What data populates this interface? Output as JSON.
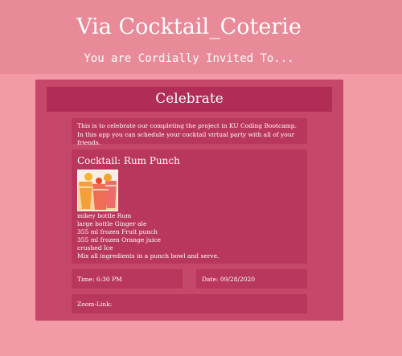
{
  "header": {
    "title": "Via Cocktail_Coterie",
    "subtitle": "You are Cordially Invited To..."
  },
  "event": {
    "title": "Celebrate",
    "description": "This is to celebrate our completing the project in KU Coding Bootcamp. In this app you can schedule your cocktail virtual party with all of your friends.",
    "time": "Time: 6:30 PM",
    "date": "Date: 09/28/2020",
    "zoom_link": "Zoom-Link:"
  },
  "recipe": {
    "title": "Cocktail: Rum Punch",
    "image_icon": "cocktail-photo",
    "ingredients": [
      "mikey bottle Rum",
      "large bottle Ginger ale",
      "355 ml frozen Fruit punch",
      "355 ml frozen Orange juice",
      "crushed Ice"
    ],
    "instructions": "Mix all ingredients in a punch bowl and serve."
  }
}
